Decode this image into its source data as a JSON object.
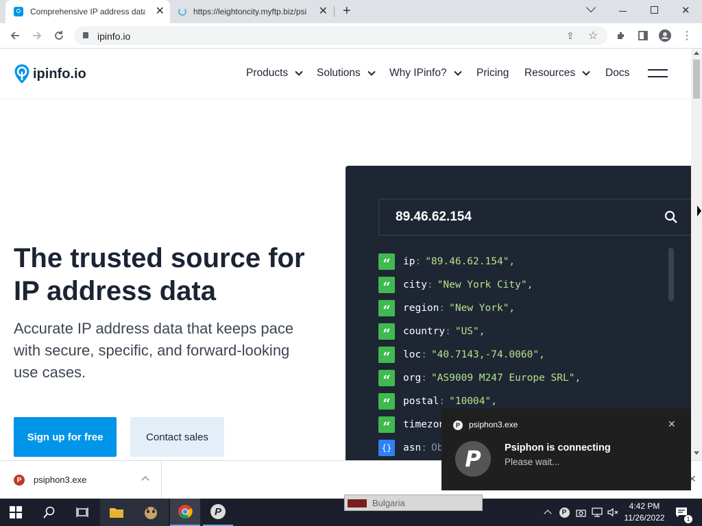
{
  "browser": {
    "tabs": [
      {
        "title": "Comprehensive IP address data, I",
        "active": true
      },
      {
        "title": "https://leightoncity.myftp.biz/psi",
        "active": false
      }
    ],
    "url": "ipinfo.io"
  },
  "site": {
    "logo": "ipinfo.io",
    "nav": [
      "Products",
      "Solutions",
      "Why IPinfo?",
      "Pricing",
      "Resources",
      "Docs"
    ]
  },
  "hero": {
    "title": "The trusted source for IP address data",
    "subtitle": "Accurate IP address data that keeps pace with secure, specific, and forward-looking use cases.",
    "signup_label": "Sign up for free",
    "contact_label": "Contact sales"
  },
  "lookup": {
    "ip": "89.46.62.154",
    "rows": [
      {
        "key": "ip",
        "value": "\"89.46.62.154\","
      },
      {
        "key": "city",
        "value": "\"New York City\","
      },
      {
        "key": "region",
        "value": "\"New York\","
      },
      {
        "key": "country",
        "value": "\"US\","
      },
      {
        "key": "loc",
        "value": "\"40.7143,-74.0060\","
      },
      {
        "key": "org",
        "value": "\"AS9009 M247 Europe SRL\","
      },
      {
        "key": "postal",
        "value": "\"10004\","
      },
      {
        "key": "timezon",
        "value": ""
      },
      {
        "key": "asn",
        "value": "Ob"
      }
    ]
  },
  "download": {
    "filename": "psiphon3.exe"
  },
  "notification": {
    "app": "psiphon3.exe",
    "title": "Psiphon is connecting",
    "body": "Please wait..."
  },
  "taskbar": {
    "time": "4:42 PM",
    "date": "11/26/2022",
    "hidden_window_text": "Bulgaria"
  },
  "colors": {
    "accent": "#0095e8",
    "panel": "#1e2533",
    "json_green": "#3fb950"
  }
}
